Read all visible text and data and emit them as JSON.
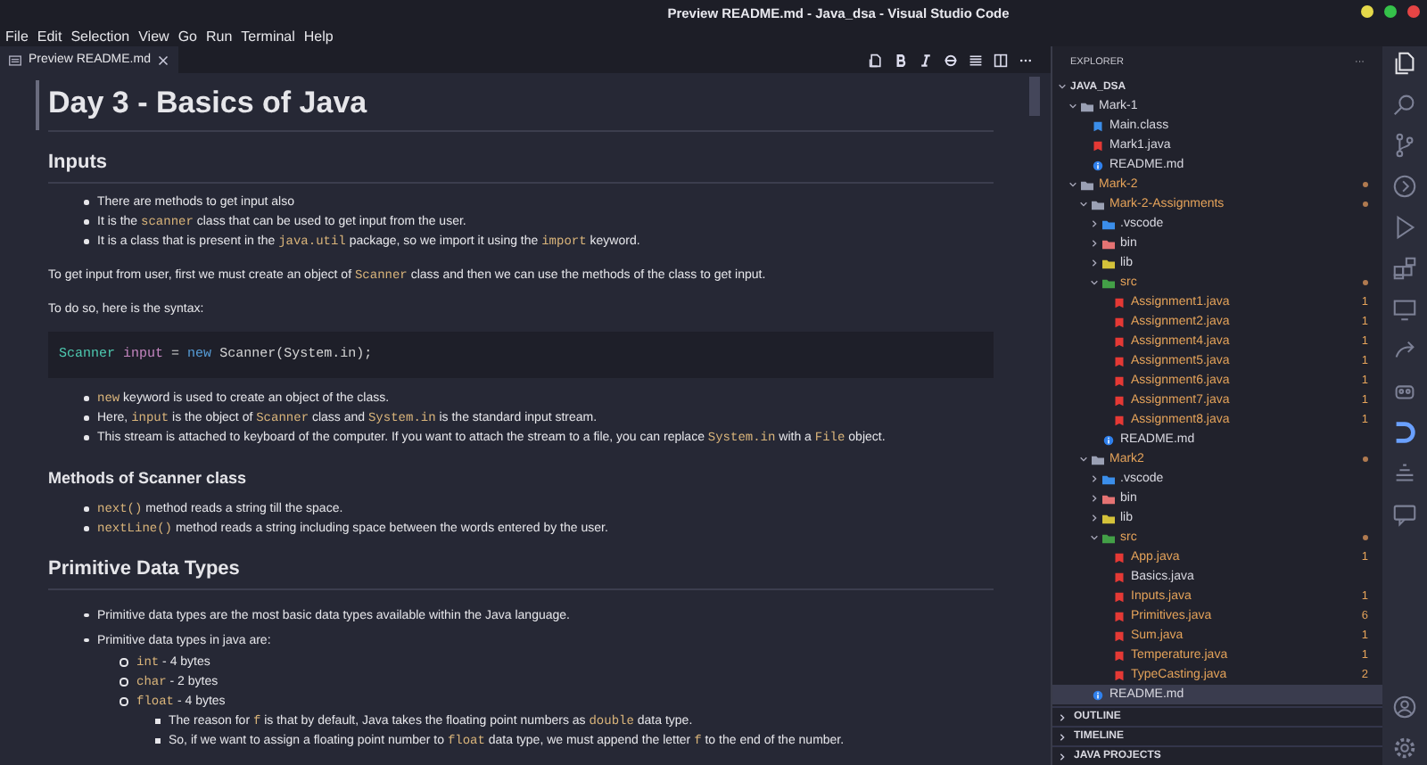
{
  "window": {
    "title": "Preview README.md - Java_dsa - Visual Studio Code"
  },
  "menu": [
    "File",
    "Edit",
    "Selection",
    "View",
    "Go",
    "Run",
    "Terminal",
    "Help"
  ],
  "tab": {
    "label": "Preview README.md",
    "selected": true
  },
  "toolbar": [
    {
      "kind": "preview"
    },
    {
      "kind": "bold"
    },
    {
      "kind": "italic"
    },
    {
      "kind": "strike"
    },
    {
      "kind": "list"
    },
    {
      "kind": "split"
    },
    {
      "kind": "more"
    }
  ],
  "document": [
    {
      "kind": "h1",
      "text": "Day 3 - Basics of Java"
    },
    {
      "kind": "h2",
      "text": "Inputs"
    },
    {
      "kind": "ul",
      "items": [
        {
          "parts": [
            {
              "kind": "text",
              "text": "There are methods to get input also"
            }
          ]
        },
        {
          "parts": [
            {
              "kind": "text",
              "text": "It is the "
            },
            {
              "kind": "code",
              "text": "scanner"
            },
            {
              "kind": "text",
              "text": " class that can be used to get input from the user."
            }
          ]
        },
        {
          "parts": [
            {
              "kind": "text",
              "text": "It is a class that is present in the "
            },
            {
              "kind": "code",
              "text": "java.util"
            },
            {
              "kind": "text",
              "text": " package, so we import it using the "
            },
            {
              "kind": "code",
              "text": "import"
            },
            {
              "kind": "text",
              "text": " keyword."
            }
          ]
        }
      ]
    },
    {
      "kind": "p",
      "parts": [
        {
          "kind": "text",
          "text": "To get input from user, first we must create an object of "
        },
        {
          "kind": "code",
          "text": "Scanner"
        },
        {
          "kind": "text",
          "text": " class and then we can use the methods of the class to get input."
        }
      ]
    },
    {
      "kind": "p",
      "parts": [
        {
          "kind": "text",
          "text": "To do so, here is the syntax:"
        }
      ]
    },
    {
      "kind": "code",
      "tokens": [
        {
          "kind": "type",
          "text": "Scanner"
        },
        {
          "kind": "var",
          "text": " input"
        },
        {
          "kind": "plain",
          "text": " = "
        },
        {
          "kind": "keyword",
          "text": "new"
        },
        {
          "kind": "plain",
          "text": " Scanner(System.in);"
        }
      ]
    },
    {
      "kind": "ul",
      "items": [
        {
          "parts": [
            {
              "kind": "code",
              "text": "new"
            },
            {
              "kind": "text",
              "text": " keyword is used to create an object of the class."
            }
          ]
        },
        {
          "parts": [
            {
              "kind": "text",
              "text": "Here, "
            },
            {
              "kind": "code",
              "text": "input"
            },
            {
              "kind": "text",
              "text": " is the object of "
            },
            {
              "kind": "code",
              "text": "Scanner"
            },
            {
              "kind": "text",
              "text": " class and "
            },
            {
              "kind": "code",
              "text": "System.in"
            },
            {
              "kind": "text",
              "text": " is the standard input stream."
            }
          ]
        },
        {
          "parts": [
            {
              "kind": "text",
              "text": "This stream is attached to keyboard of the computer. If you want to attach the stream to a file, you can replace "
            },
            {
              "kind": "code",
              "text": "System.in"
            },
            {
              "kind": "text",
              "text": " with a "
            },
            {
              "kind": "code",
              "text": "File"
            },
            {
              "kind": "text",
              "text": " object."
            }
          ]
        }
      ]
    },
    {
      "kind": "h3",
      "text": "Methods of Scanner class"
    },
    {
      "kind": "ul",
      "items": [
        {
          "parts": [
            {
              "kind": "code",
              "text": "next()"
            },
            {
              "kind": "text",
              "text": " method reads a string till the space."
            }
          ]
        },
        {
          "parts": [
            {
              "kind": "code",
              "text": "nextLine()"
            },
            {
              "kind": "text",
              "text": " method reads a string including space between the words entered by the user."
            }
          ]
        }
      ]
    },
    {
      "kind": "h2",
      "text": "Primitive Data Types"
    },
    {
      "kind": "ul",
      "loose": true,
      "items": [
        {
          "parts": [
            {
              "kind": "text",
              "text": "Primitive data types are the most basic data types available within the Java language."
            }
          ]
        },
        {
          "parts": [
            {
              "kind": "text",
              "text": "Primitive data types in java are:"
            }
          ],
          "children": [
            {
              "parts": [
                {
                  "kind": "code",
                  "text": "int"
                },
                {
                  "kind": "text",
                  "text": " - 4 bytes"
                }
              ]
            },
            {
              "parts": [
                {
                  "kind": "code",
                  "text": "char"
                },
                {
                  "kind": "text",
                  "text": " - 2 bytes"
                }
              ]
            },
            {
              "parts": [
                {
                  "kind": "code",
                  "text": "float"
                },
                {
                  "kind": "text",
                  "text": " - 4 bytes"
                }
              ],
              "children": [
                {
                  "parts": [
                    {
                      "kind": "text",
                      "text": "The reason for "
                    },
                    {
                      "kind": "code",
                      "text": "f"
                    },
                    {
                      "kind": "text",
                      "text": " is that by default, Java takes the floating point numbers as "
                    },
                    {
                      "kind": "code",
                      "text": "double"
                    },
                    {
                      "kind": "text",
                      "text": " data type."
                    }
                  ]
                },
                {
                  "parts": [
                    {
                      "kind": "text",
                      "text": "So, if we want to assign a floating point number to "
                    },
                    {
                      "kind": "code",
                      "text": "float"
                    },
                    {
                      "kind": "text",
                      "text": " data type, we must append the letter "
                    },
                    {
                      "kind": "code",
                      "text": "f"
                    },
                    {
                      "kind": "text",
                      "text": " to the end of the number."
                    }
                  ]
                }
              ]
            }
          ]
        }
      ]
    }
  ],
  "explorer": {
    "title": "EXPLORER",
    "more": "···",
    "tree": [
      {
        "label": "JAVA_DSA",
        "kind": "root",
        "expanded": true,
        "selected": false,
        "modified": false,
        "children": [
          {
            "label": "Mark-1",
            "kind": "folder",
            "expanded": true,
            "selected": false,
            "modified": false,
            "children": [
              {
                "label": "Main.class",
                "kind": "class",
                "selected": false,
                "modified": false
              },
              {
                "label": "Mark1.java",
                "kind": "java",
                "selected": false,
                "modified": false
              },
              {
                "label": "README.md",
                "kind": "info",
                "selected": false,
                "modified": false
              }
            ]
          },
          {
            "label": "Mark-2",
            "kind": "folder",
            "expanded": true,
            "selected": false,
            "modified": true,
            "children": [
              {
                "label": "Mark-2-Assignments",
                "kind": "folder",
                "expanded": true,
                "selected": false,
                "modified": true,
                "children": [
                  {
                    "label": ".vscode",
                    "kind": "vscode",
                    "expanded": false,
                    "selected": false,
                    "modified": false
                  },
                  {
                    "label": "bin",
                    "kind": "bin",
                    "expanded": false,
                    "selected": false,
                    "modified": false
                  },
                  {
                    "label": "lib",
                    "kind": "lib",
                    "expanded": false,
                    "selected": false,
                    "modified": false
                  },
                  {
                    "label": "src",
                    "kind": "src",
                    "expanded": true,
                    "selected": false,
                    "modified": true,
                    "children": [
                      {
                        "label": "Assignment1.java",
                        "kind": "java",
                        "selected": false,
                        "modified": true,
                        "problems": "1"
                      },
                      {
                        "label": "Assignment2.java",
                        "kind": "java",
                        "selected": false,
                        "modified": true,
                        "problems": "1"
                      },
                      {
                        "label": "Assignment4.java",
                        "kind": "java",
                        "selected": false,
                        "modified": true,
                        "problems": "1"
                      },
                      {
                        "label": "Assignment5.java",
                        "kind": "java",
                        "selected": false,
                        "modified": true,
                        "problems": "1"
                      },
                      {
                        "label": "Assignment6.java",
                        "kind": "java",
                        "selected": false,
                        "modified": true,
                        "problems": "1"
                      },
                      {
                        "label": "Assignment7.java",
                        "kind": "java",
                        "selected": false,
                        "modified": true,
                        "problems": "1"
                      },
                      {
                        "label": "Assignment8.java",
                        "kind": "java",
                        "selected": false,
                        "modified": true,
                        "problems": "1"
                      }
                    ]
                  },
                  {
                    "label": "README.md",
                    "kind": "info",
                    "selected": false,
                    "modified": false
                  }
                ]
              },
              {
                "label": "Mark2",
                "kind": "folder",
                "expanded": true,
                "selected": false,
                "modified": true,
                "children": [
                  {
                    "label": ".vscode",
                    "kind": "vscode",
                    "expanded": false,
                    "selected": false,
                    "modified": false
                  },
                  {
                    "label": "bin",
                    "kind": "bin",
                    "expanded": false,
                    "selected": false,
                    "modified": false
                  },
                  {
                    "label": "lib",
                    "kind": "lib",
                    "expanded": false,
                    "selected": false,
                    "modified": false
                  },
                  {
                    "label": "src",
                    "kind": "src",
                    "expanded": true,
                    "selected": false,
                    "modified": true,
                    "children": [
                      {
                        "label": "App.java",
                        "kind": "java",
                        "selected": false,
                        "modified": true,
                        "problems": "1"
                      },
                      {
                        "label": "Basics.java",
                        "kind": "java",
                        "selected": false,
                        "modified": false
                      },
                      {
                        "label": "Inputs.java",
                        "kind": "java",
                        "selected": false,
                        "modified": true,
                        "problems": "1"
                      },
                      {
                        "label": "Primitives.java",
                        "kind": "java",
                        "selected": false,
                        "modified": true,
                        "problems": "6"
                      },
                      {
                        "label": "Sum.java",
                        "kind": "java",
                        "selected": false,
                        "modified": true,
                        "problems": "1"
                      },
                      {
                        "label": "Temperature.java",
                        "kind": "java",
                        "selected": false,
                        "modified": true,
                        "problems": "1"
                      },
                      {
                        "label": "TypeCasting.java",
                        "kind": "java",
                        "selected": false,
                        "modified": true,
                        "problems": "2"
                      }
                    ]
                  }
                ]
              },
              {
                "label": "README.md",
                "kind": "info",
                "selected": true,
                "modified": false
              }
            ]
          }
        ]
      }
    ]
  },
  "panels": [
    {
      "label": "OUTLINE",
      "expanded": false
    },
    {
      "label": "TIMELINE",
      "expanded": false
    },
    {
      "label": "JAVA PROJECTS",
      "expanded": false
    }
  ],
  "activity_bar": [
    {
      "kind": "files",
      "selected": true
    },
    {
      "kind": "search",
      "selected": false
    },
    {
      "kind": "branch",
      "selected": false
    },
    {
      "kind": "circle-play",
      "selected": false
    },
    {
      "kind": "run",
      "selected": false
    },
    {
      "kind": "extensions",
      "selected": false
    },
    {
      "kind": "monitor",
      "selected": false
    },
    {
      "kind": "share",
      "selected": false
    },
    {
      "kind": "robot",
      "selected": false
    },
    {
      "kind": "d-logo",
      "selected": false
    },
    {
      "kind": "stack",
      "selected": false
    },
    {
      "kind": "chat",
      "selected": false
    }
  ],
  "activity_bottom": [
    {
      "kind": "account",
      "selected": false
    },
    {
      "kind": "gear",
      "selected": false
    }
  ]
}
